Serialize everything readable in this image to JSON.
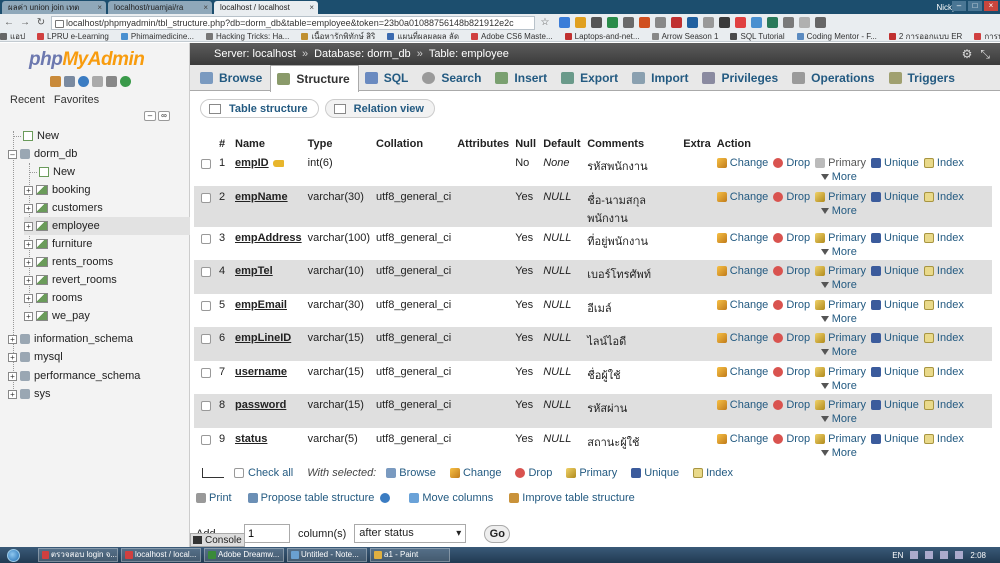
{
  "browser": {
    "tabs": [
      "ผลค่า union join เทต",
      "localhost/ruamjai/ra",
      "localhost / localhost"
    ],
    "profile": "Nicky",
    "url": "localhost/phpmyadmin/tbl_structure.php?db=dorm_db&table=employee&token=23b0a01088756148b821912e2c",
    "bookmarks": [
      "แอป",
      "LPRU e-Learning",
      "Phimaimedicine...",
      "Hacking Tricks: Ha...",
      "เนื้อหารักพิทักษ์ สิริ",
      "แผนที่ผลผลผล ลัด",
      "Adobe CS6 Maste...",
      "Laptops-and-net...",
      "Arrow Season 1",
      "SQL Tutorial",
      "Coding Mentor - F...",
      "2 การออกแบบ ER",
      "การนำเมาะหมาเราม"
    ]
  },
  "sidebar": {
    "logo_php": "php",
    "logo_myadmin": "MyAdmin",
    "recent": "Recent",
    "favorites": "Favorites",
    "tree": [
      {
        "label": "New",
        "level": 0
      },
      {
        "label": "dorm_db",
        "level": 0
      },
      {
        "label": "New",
        "level": 1
      },
      {
        "label": "booking",
        "level": 1
      },
      {
        "label": "customers",
        "level": 1
      },
      {
        "label": "employee",
        "level": 1
      },
      {
        "label": "furniture",
        "level": 1
      },
      {
        "label": "rents_rooms",
        "level": 1
      },
      {
        "label": "revert_rooms",
        "level": 1
      },
      {
        "label": "rooms",
        "level": 1
      },
      {
        "label": "we_pay",
        "level": 1
      },
      {
        "label": "information_schema",
        "level": 0
      },
      {
        "label": "mysql",
        "level": 0
      },
      {
        "label": "performance_schema",
        "level": 0
      },
      {
        "label": "sys",
        "level": 0
      }
    ]
  },
  "breadcrumb": {
    "server": "Server: localhost",
    "database": "Database: dorm_db",
    "table": "Table: employee"
  },
  "tabs": [
    "Browse",
    "Structure",
    "SQL",
    "Search",
    "Insert",
    "Export",
    "Import",
    "Privileges",
    "Operations",
    "Triggers"
  ],
  "subtabs": [
    "Table structure",
    "Relation view"
  ],
  "columns": [
    "#",
    "Name",
    "Type",
    "Collation",
    "Attributes",
    "Null",
    "Default",
    "Comments",
    "Extra",
    "Action"
  ],
  "rows": [
    {
      "n": "1",
      "name": "empID",
      "type": "int(6)",
      "collation": "",
      "null": "No",
      "default": "None",
      "comment": "รหัสพนักงาน",
      "key": true
    },
    {
      "n": "2",
      "name": "empName",
      "type": "varchar(30)",
      "collation": "utf8_general_ci",
      "null": "Yes",
      "default": "NULL",
      "comment": "ชื่อ-นามสกุล",
      "comment2": "พนักงาน"
    },
    {
      "n": "3",
      "name": "empAddress",
      "type": "varchar(100)",
      "collation": "utf8_general_ci",
      "null": "Yes",
      "default": "NULL",
      "comment": "ที่อยู่พนักงาน"
    },
    {
      "n": "4",
      "name": "empTel",
      "type": "varchar(10)",
      "collation": "utf8_general_ci",
      "null": "Yes",
      "default": "NULL",
      "comment": "เบอร์โทรศัพท์"
    },
    {
      "n": "5",
      "name": "empEmail",
      "type": "varchar(30)",
      "collation": "utf8_general_ci",
      "null": "Yes",
      "default": "NULL",
      "comment": "อีเมล์"
    },
    {
      "n": "6",
      "name": "empLineID",
      "type": "varchar(15)",
      "collation": "utf8_general_ci",
      "null": "Yes",
      "default": "NULL",
      "comment": "ไลน์ไอดี"
    },
    {
      "n": "7",
      "name": "username",
      "type": "varchar(15)",
      "collation": "utf8_general_ci",
      "null": "Yes",
      "default": "NULL",
      "comment": "ชื่อผู้ใช้"
    },
    {
      "n": "8",
      "name": "password",
      "type": "varchar(15)",
      "collation": "utf8_general_ci",
      "null": "Yes",
      "default": "NULL",
      "comment": "รหัสผ่าน"
    },
    {
      "n": "9",
      "name": "status",
      "type": "varchar(5)",
      "collation": "utf8_general_ci",
      "null": "Yes",
      "default": "NULL",
      "comment": "สถานะผู้ใช้"
    }
  ],
  "actions": {
    "change": "Change",
    "drop": "Drop",
    "primary": "Primary",
    "unique": "Unique",
    "index": "Index",
    "more": "More"
  },
  "bulk": {
    "check_all": "Check all",
    "with_selected": "With selected:",
    "browse": "Browse",
    "change": "Change",
    "drop": "Drop",
    "primary": "Primary",
    "unique": "Unique",
    "index": "Index"
  },
  "bottom_links": {
    "print": "Print",
    "propose": "Propose table structure",
    "move": "Move columns",
    "improve": "Improve table structure"
  },
  "add_columns": {
    "prefix": "Add",
    "value": "1",
    "label": "column(s)",
    "position": "after status",
    "go": "Go",
    "console": "Console"
  },
  "taskbar": {
    "tasks": [
      "ตรวจสอบ login จ...",
      "localhost / local...",
      "Adobe Dreamw...",
      "Untitled - Note...",
      "a1 - Paint"
    ],
    "lang": "EN",
    "time": "2:08"
  }
}
